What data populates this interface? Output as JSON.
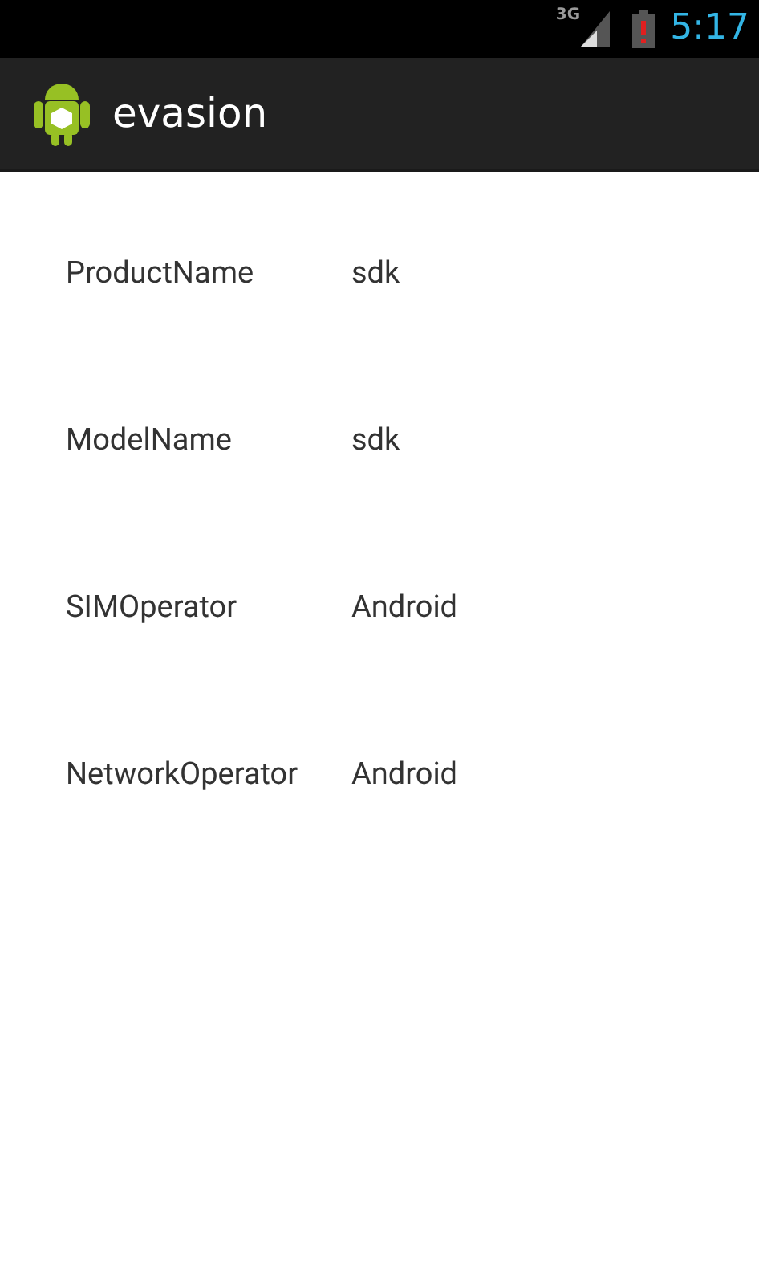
{
  "status_bar": {
    "network": "3G",
    "time": "5:17"
  },
  "action_bar": {
    "title": "evasion"
  },
  "rows": [
    {
      "label": "ProductName",
      "value": "sdk"
    },
    {
      "label": "ModelName",
      "value": "sdk"
    },
    {
      "label": "SIMOperator",
      "value": "Android"
    },
    {
      "label": "NetworkOperator",
      "value": "Android"
    }
  ]
}
